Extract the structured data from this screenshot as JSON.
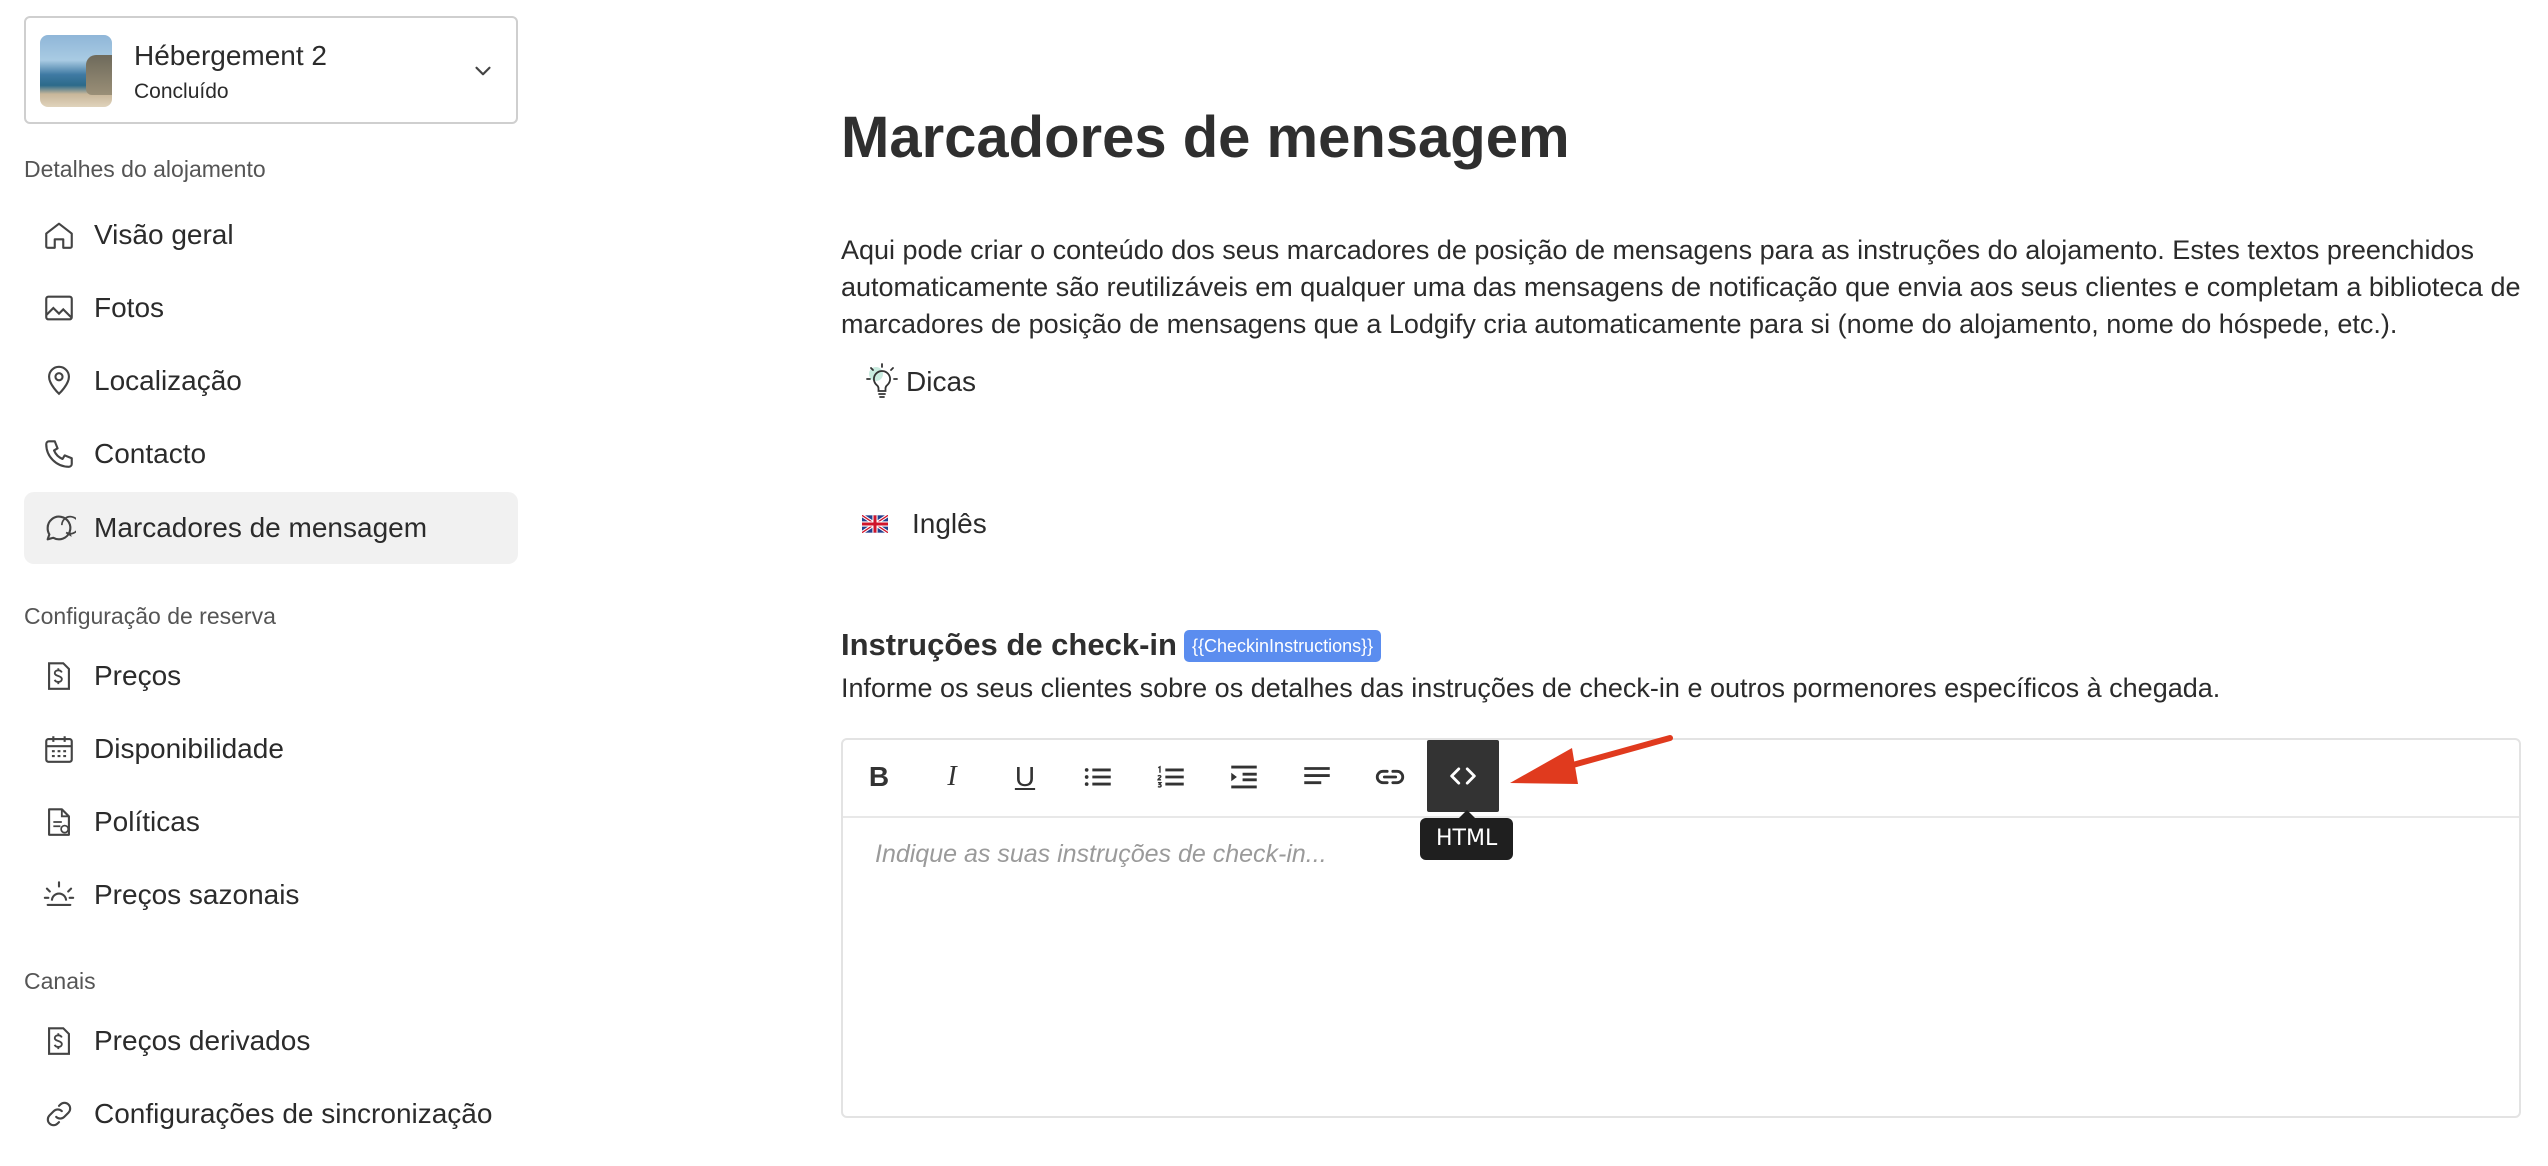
{
  "property": {
    "name": "Hébergement 2",
    "status": "Concluído"
  },
  "sidebar": {
    "sections": [
      {
        "label": "Detalhes do alojamento"
      },
      {
        "label": "Configuração de reserva"
      },
      {
        "label": "Canais"
      }
    ],
    "items": [
      {
        "label": "Visão geral",
        "icon": "home-icon"
      },
      {
        "label": "Fotos",
        "icon": "image-icon"
      },
      {
        "label": "Localização",
        "icon": "location-pin-icon"
      },
      {
        "label": "Contacto",
        "icon": "phone-icon"
      },
      {
        "label": "Marcadores de mensagem",
        "icon": "chat-icon",
        "active": true
      },
      {
        "label": "Preços",
        "icon": "price-tag-icon"
      },
      {
        "label": "Disponibilidade",
        "icon": "calendar-icon"
      },
      {
        "label": "Políticas",
        "icon": "document-icon"
      },
      {
        "label": "Preços sazonais",
        "icon": "sun-icon"
      },
      {
        "label": "Preços derivados",
        "icon": "price-tag-icon"
      },
      {
        "label": "Configurações de sincronização",
        "icon": "link-icon"
      }
    ]
  },
  "main": {
    "title": "Marcadores de mensagem",
    "intro": "Aqui pode criar o conteúdo dos seus marcadores de posição de mensagens para as instruções do alojamento. Estes textos preenchidos automaticamente são reutilizáveis em qualquer uma das mensagens de notificação que envia aos seus clientes e completam a biblioteca de marcadores de posição de mensagens que a Lodgify cria automaticamente para si (nome do alojamento, nome do hóspede, etc.).",
    "tips_label": "Dicas",
    "language_label": "Inglês",
    "field": {
      "title": "Instruções de check-in",
      "placeholder_tag": "{{CheckinInstructions}}",
      "help": "Informe os seus clientes sobre os detalhes das instruções de check-in e outros pormenores específicos à chegada.",
      "editor_placeholder": "Indique as suas instruções de check-in..."
    },
    "toolbar": {
      "bold": "B",
      "italic": "I",
      "underline": "U",
      "tooltip": "HTML"
    }
  },
  "colors": {
    "accent_tag": "#5b8def",
    "active_nav_bg": "#f1f1f1",
    "annotation_arrow": "#e03a1e"
  }
}
